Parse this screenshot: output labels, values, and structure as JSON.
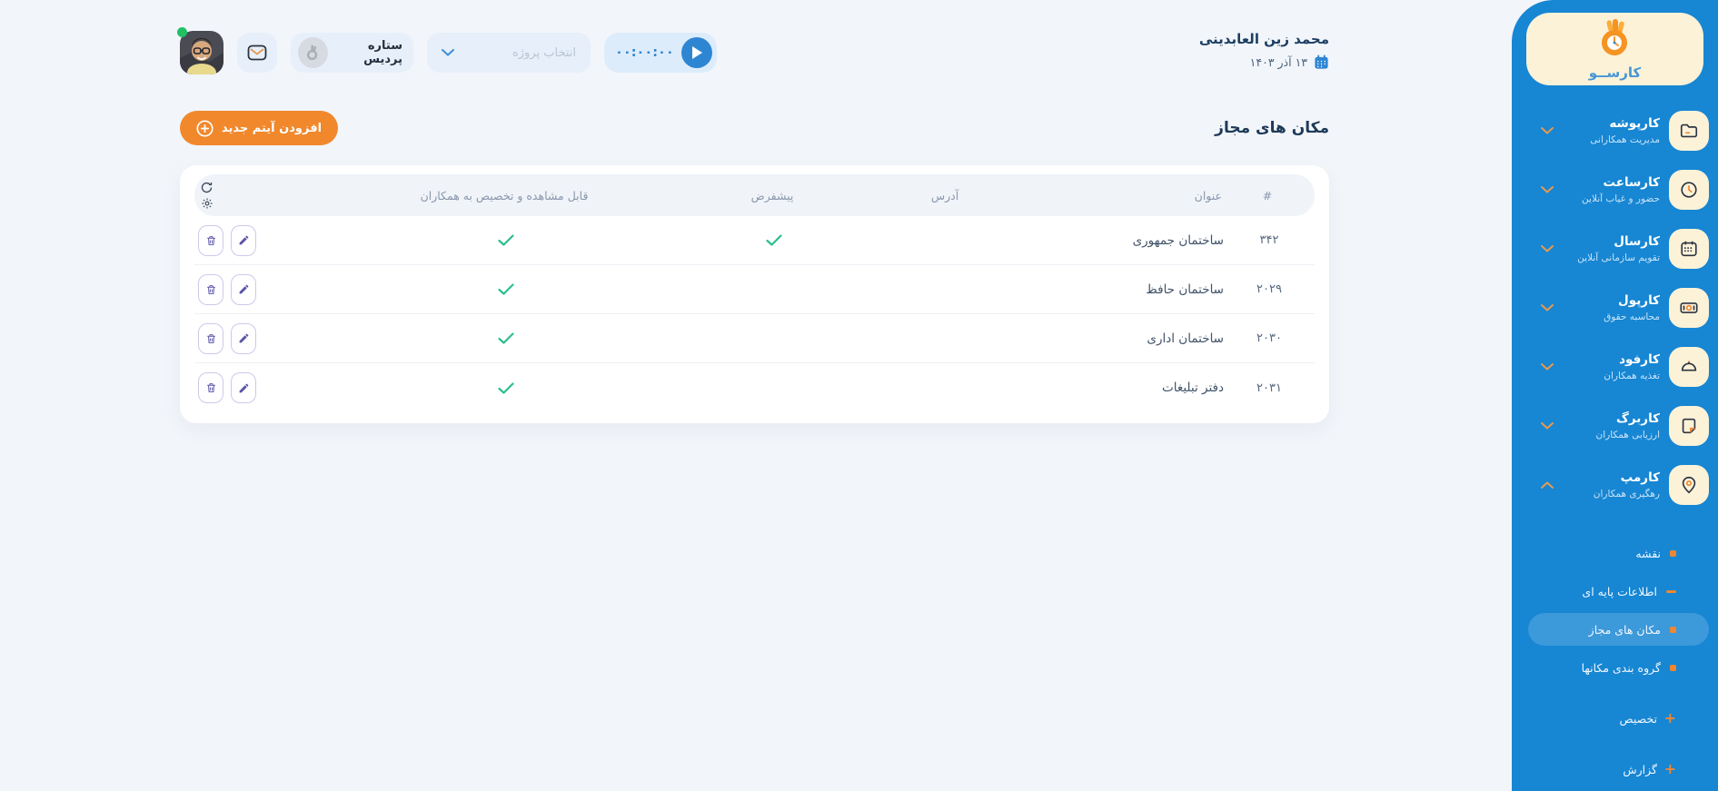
{
  "colors": {
    "sidebar_blue": "#1786d3",
    "cream": "#fbf2d8",
    "orange": "#f1882c",
    "bullet_orange": "#ef8632",
    "green_check": "#2cbf8e",
    "indigo_action": "#5b54a8",
    "timer_blue": "#2e86d3",
    "bg": "#f2f5fa",
    "online_green": "#21c065"
  },
  "sidebar": {
    "logo": {
      "title": "کارســو",
      "icon": "karso-hand-clock-logo"
    },
    "menu": [
      {
        "title": "کارپوشه",
        "subtitle": "مدیریت همکارانی",
        "icon": "folder-icon",
        "state": "collapsed"
      },
      {
        "title": "کارساعت",
        "subtitle": "حضور و غیاب آنلاین",
        "icon": "clock-icon",
        "state": "collapsed"
      },
      {
        "title": "کارسال",
        "subtitle": "تقویم سازمانی آنلاین",
        "icon": "calendar-icon",
        "state": "collapsed"
      },
      {
        "title": "کارپول",
        "subtitle": "محاسبه حقوق",
        "icon": "banknote-icon",
        "state": "collapsed"
      },
      {
        "title": "کارفود",
        "subtitle": "تغذیه همکاران",
        "icon": "food-cloche-icon",
        "state": "collapsed"
      },
      {
        "title": "کاربرگ",
        "subtitle": "ارزیابی همکاران",
        "icon": "sheet-icon",
        "state": "collapsed"
      },
      {
        "title": "کارمپ",
        "subtitle": "رهگیری همکاران",
        "icon": "map-pin-icon",
        "state": "expanded"
      }
    ],
    "submenu": [
      {
        "label": "نقشه",
        "bullet": "square",
        "active": false
      },
      {
        "label": "اطلاعات پایه ای",
        "bullet": "dash",
        "active": false
      },
      {
        "label": "مکان های مجاز",
        "bullet": "square",
        "active": true
      },
      {
        "label": "گروه بندی مکانها",
        "bullet": "square",
        "active": false
      },
      {
        "label": "تخصیص",
        "bullet": "plus",
        "active": false
      },
      {
        "label": "گزارش",
        "bullet": "plus",
        "active": false
      }
    ]
  },
  "topbar": {
    "user_name": "محمد زین العابدینی",
    "date": "۱۳ آذر ۱۴۰۳",
    "timer": "۰۰:۰۰:۰۰",
    "project_placeholder": "انتخاب پروژه",
    "workspace": "ستاره پردیس"
  },
  "page": {
    "title": "مکان های مجاز",
    "add_button": "افزودن آیتم جدید"
  },
  "table": {
    "headers": {
      "id": "#",
      "title": "عنوان",
      "address": "آدرس",
      "default": "پیشفرض",
      "visible": "قابل مشاهده و تخصیص به همکاران"
    },
    "rows": [
      {
        "id": "۳۴۲",
        "title": "ساختمان جمهوری",
        "address": "",
        "default": true,
        "visible": true
      },
      {
        "id": "۲۰۲۹",
        "title": "ساختمان حافظ",
        "address": "",
        "default": false,
        "visible": true
      },
      {
        "id": "۲۰۳۰",
        "title": "ساختمان اداری",
        "address": "",
        "default": false,
        "visible": true
      },
      {
        "id": "۲۰۳۱",
        "title": "دفتر تبلیغات",
        "address": "",
        "default": false,
        "visible": true
      }
    ]
  }
}
